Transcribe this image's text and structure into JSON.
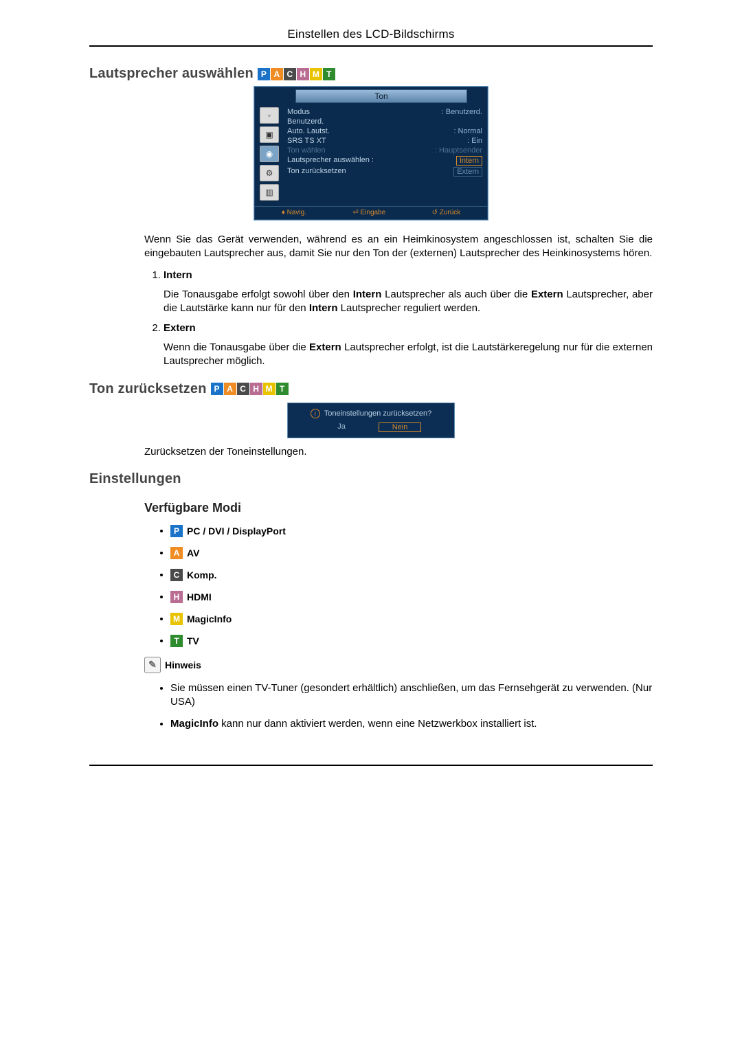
{
  "header": {
    "title": "Einstellen des LCD-Bildschirms"
  },
  "section1": {
    "title": "Lautsprecher auswählen",
    "chips": [
      "P",
      "A",
      "C",
      "H",
      "M",
      "T"
    ],
    "osd": {
      "title": "Ton",
      "rows": [
        {
          "label": "Modus",
          "value": ": Benutzerd."
        },
        {
          "label": "Benutzerd.",
          "value": ""
        },
        {
          "label": "Auto. Lautst.",
          "value": ": Normal"
        },
        {
          "label": "SRS TS XT",
          "value": ": Ein"
        },
        {
          "label": "Ton wählen",
          "value": ": Hauptsender"
        },
        {
          "label": "Lautsprecher auswählen :",
          "value": "Intern"
        },
        {
          "label": "Ton zurücksetzen",
          "value": "Extern"
        }
      ],
      "footer": {
        "nav": "Navig.",
        "enter": "Eingabe",
        "back": "Zurück"
      }
    },
    "intro": "Wenn Sie das Gerät verwenden, während es an ein Heimkinosystem angeschlossen ist, schalten Sie die eingebauten Lautsprecher aus, damit Sie nur den Ton der (externen) Lautsprecher des Heinkinosystems hören.",
    "items": [
      {
        "label": "Intern",
        "desc_pre": "Die Tonausgabe erfolgt sowohl über den ",
        "b1": "Intern",
        "desc_mid": " Lautsprecher als auch über die ",
        "b2": "Extern",
        "desc_mid2": " Lautsprecher, aber die Lautstärke kann nur für den ",
        "b3": "Intern",
        "desc_post": " Lautsprecher reguliert werden."
      },
      {
        "label": "Extern",
        "desc_pre": "Wenn die Tonausgabe über die ",
        "b1": "Extern",
        "desc_mid": " Lautsprecher erfolgt, ist die Lautstärkeregelung nur für die externen Lautsprecher möglich.",
        "b2": "",
        "desc_mid2": "",
        "b3": "",
        "desc_post": ""
      }
    ]
  },
  "section2": {
    "title": "Ton zurücksetzen",
    "chips": [
      "P",
      "A",
      "C",
      "H",
      "M",
      "T"
    ],
    "dialog": {
      "msg": "Toneinstellungen zurücksetzen?",
      "yes": "Ja",
      "no": "Nein"
    },
    "desc": "Zurücksetzen der Toneinstellungen."
  },
  "section3": {
    "title": "Einstellungen"
  },
  "modes": {
    "title": "Verfügbare Modi",
    "items": [
      {
        "chip": "P",
        "label": "PC / DVI / DisplayPort"
      },
      {
        "chip": "A",
        "label": "AV"
      },
      {
        "chip": "C",
        "label": "Komp."
      },
      {
        "chip": "H",
        "label": "HDMI"
      },
      {
        "chip": "M",
        "label": "MagicInfo"
      },
      {
        "chip": "T",
        "label": "TV"
      }
    ]
  },
  "hinweis": {
    "label": "Hinweis",
    "notes": [
      {
        "pre": "Sie müssen einen TV-Tuner (gesondert erhältlich) anschließen, um das Fernsehgerät zu verwenden. (Nur USA)",
        "bold": "",
        "post": ""
      },
      {
        "pre": "",
        "bold": "MagicInfo",
        "post": " kann nur dann aktiviert werden, wenn eine Netzwerkbox installiert ist."
      }
    ]
  }
}
